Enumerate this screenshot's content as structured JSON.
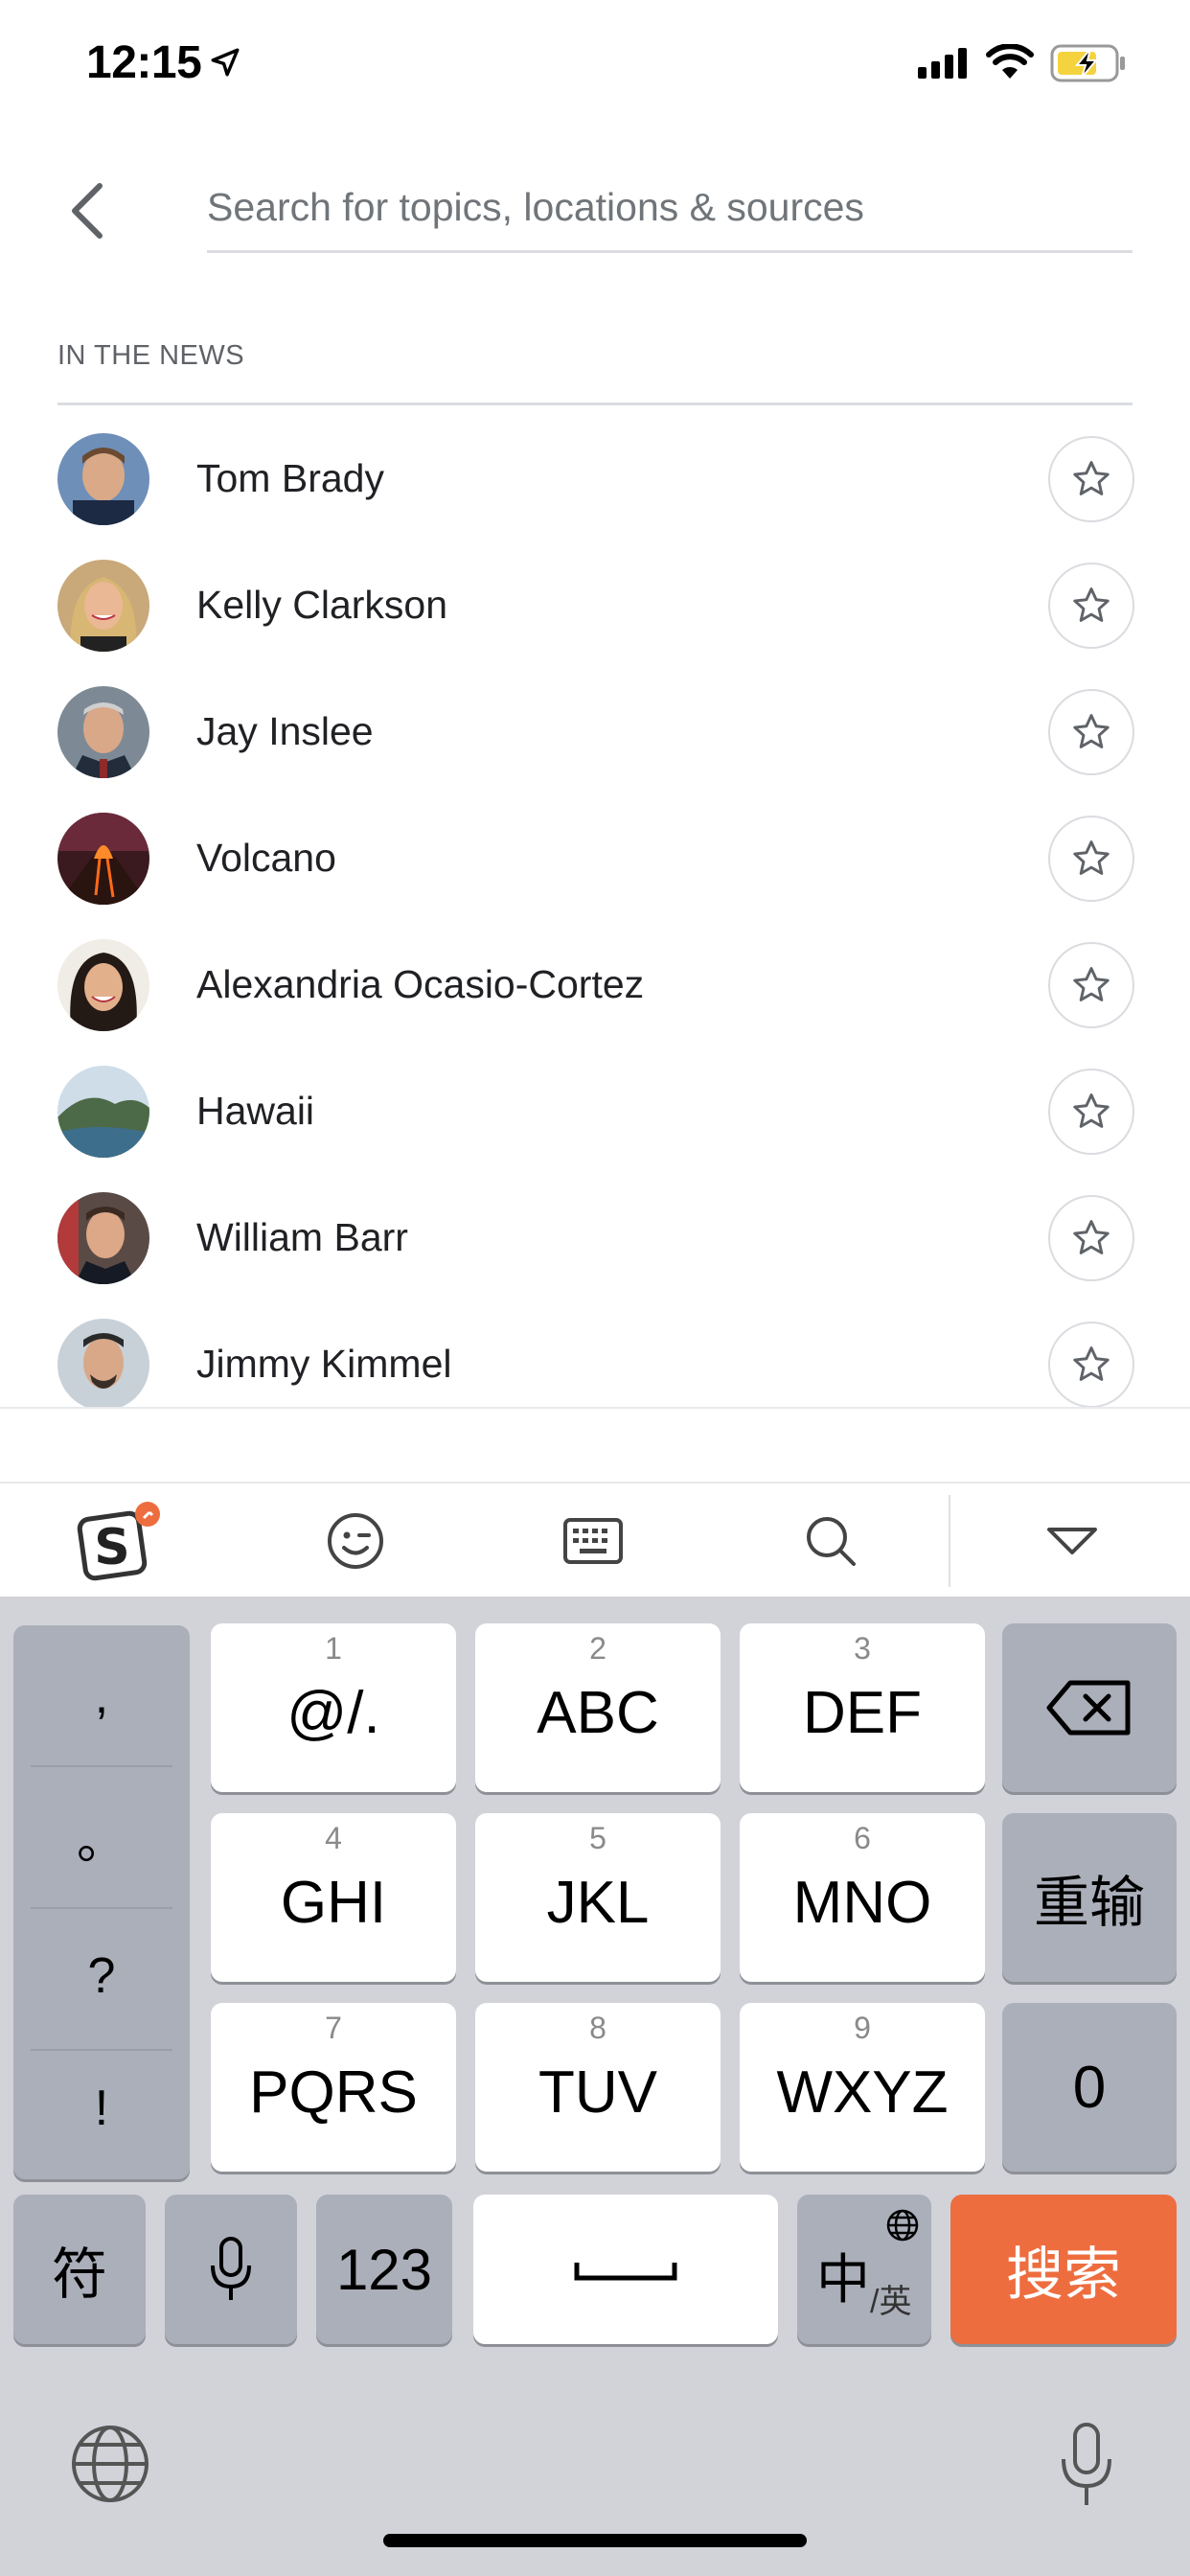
{
  "status_bar": {
    "time": "12:15"
  },
  "search": {
    "placeholder": "Search for topics, locations & sources",
    "value": ""
  },
  "section": {
    "title": "IN THE NEWS"
  },
  "news_items": [
    {
      "label": "Tom Brady"
    },
    {
      "label": "Kelly Clarkson"
    },
    {
      "label": "Jay Inslee"
    },
    {
      "label": "Volcano"
    },
    {
      "label": "Alexandria Ocasio-Cortez"
    },
    {
      "label": "Hawaii"
    },
    {
      "label": "William Barr"
    },
    {
      "label": "Jimmy Kimmel"
    }
  ],
  "keyboard": {
    "punctuation": [
      ",",
      "。",
      "?",
      "!"
    ],
    "keys": [
      {
        "num": "1",
        "main": "@/."
      },
      {
        "num": "2",
        "main": "ABC"
      },
      {
        "num": "3",
        "main": "DEF"
      },
      {
        "num": "4",
        "main": "GHI"
      },
      {
        "num": "5",
        "main": "JKL"
      },
      {
        "num": "6",
        "main": "MNO"
      },
      {
        "num": "7",
        "main": "PQRS"
      },
      {
        "num": "8",
        "main": "TUV"
      },
      {
        "num": "9",
        "main": "WXYZ"
      }
    ],
    "reenter": "重输",
    "zero": "0",
    "symbols": "符",
    "num_mode": "123",
    "lang_main": "中",
    "lang_sub": "/英",
    "search": "搜索"
  },
  "colors": {
    "accent": "#ee6d3f",
    "keyboard_bg": "#d1d3d9"
  }
}
